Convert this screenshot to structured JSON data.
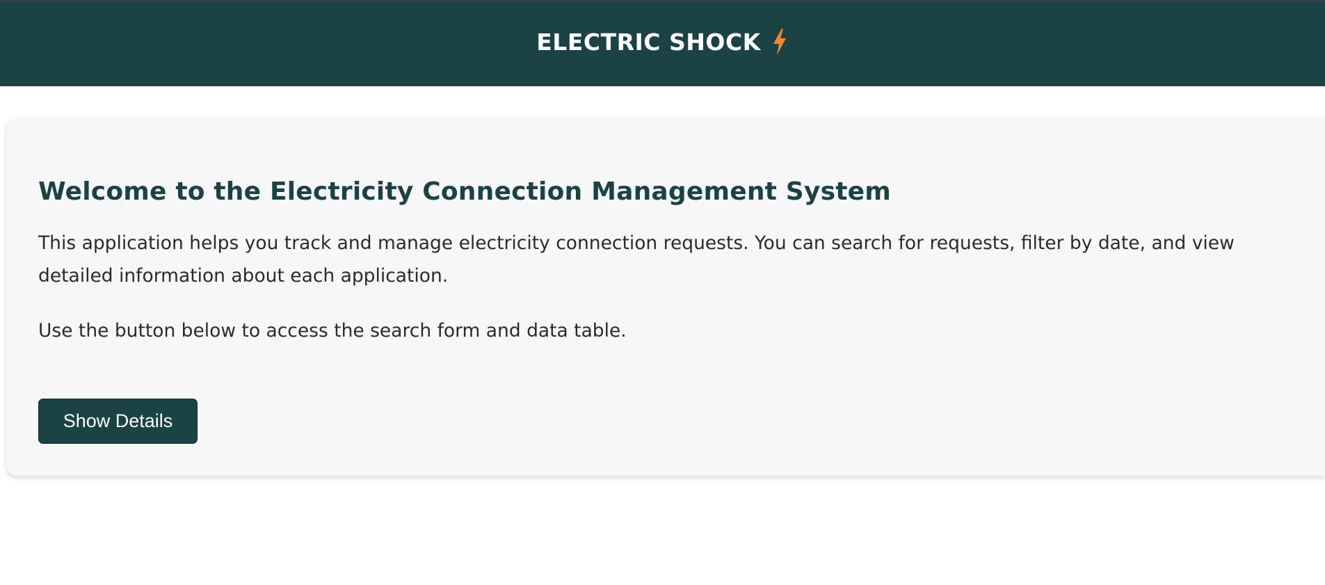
{
  "header": {
    "title": "ELECTRIC SHOCK",
    "icon": "lightning-bolt-icon",
    "background_color": "#1b4244",
    "icon_color": "#f08a2b"
  },
  "welcome": {
    "title": "Welcome to the Electricity Connection Management System",
    "paragraph1": "This application helps you track and manage electricity connection requests. You can search for requests, filter by date, and view detailed information about each application.",
    "paragraph2": "Use the button below to access the search form and data table.",
    "button_label": "Show Details"
  }
}
